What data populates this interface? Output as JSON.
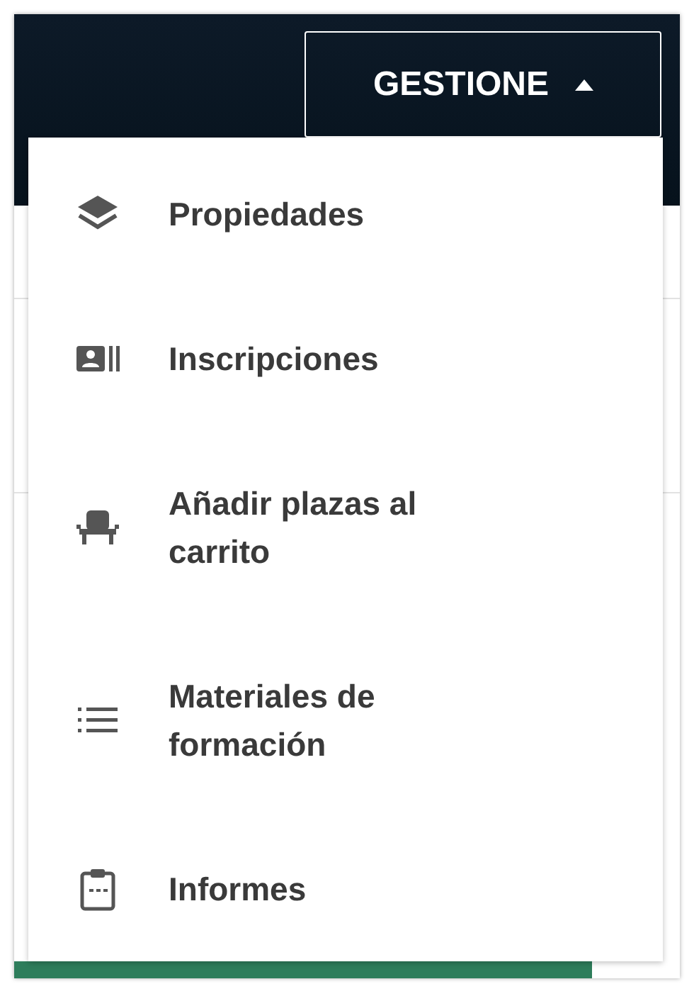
{
  "header": {
    "button": {
      "label": "GESTIONE",
      "expanded": true
    }
  },
  "menu": {
    "items": [
      {
        "label": "Propiedades",
        "kind": "layers"
      },
      {
        "label": "Inscripciones",
        "kind": "card"
      },
      {
        "label": "Añadir plazas al carrito",
        "kind": "seat"
      },
      {
        "label": "Materiales de formación",
        "kind": "list"
      },
      {
        "label": "Informes",
        "kind": "clipboard"
      }
    ]
  }
}
